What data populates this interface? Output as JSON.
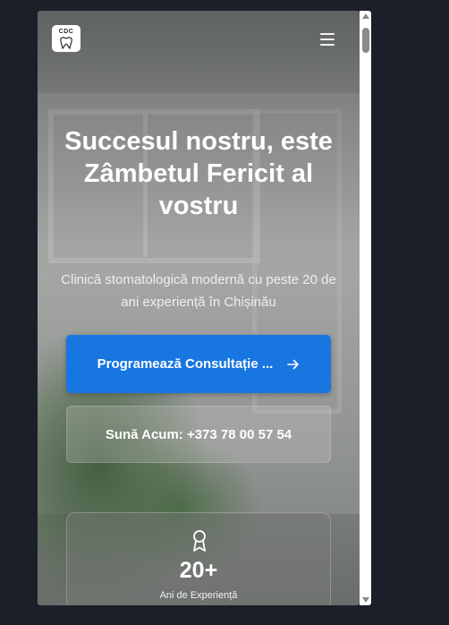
{
  "header": {
    "logo_text": "CDC",
    "menu_icon": "hamburger-icon"
  },
  "hero": {
    "title": "Succesul nostru, este Zâmbetul Fericit al vostru",
    "subtitle": "Clinică stomatologică modernă cu peste 20 de ani experiență în Chișinău"
  },
  "buttons": {
    "primary_label": "Programează Consultație ...",
    "primary_icon": "arrow-right-icon",
    "secondary_label": "Sună Acum: +373 78 00 57 54"
  },
  "stat": {
    "icon": "award-icon",
    "value": "20+",
    "label": "Ani de Experiență"
  },
  "colors": {
    "accent": "#1876e0",
    "page_background": "#1c1f28"
  }
}
